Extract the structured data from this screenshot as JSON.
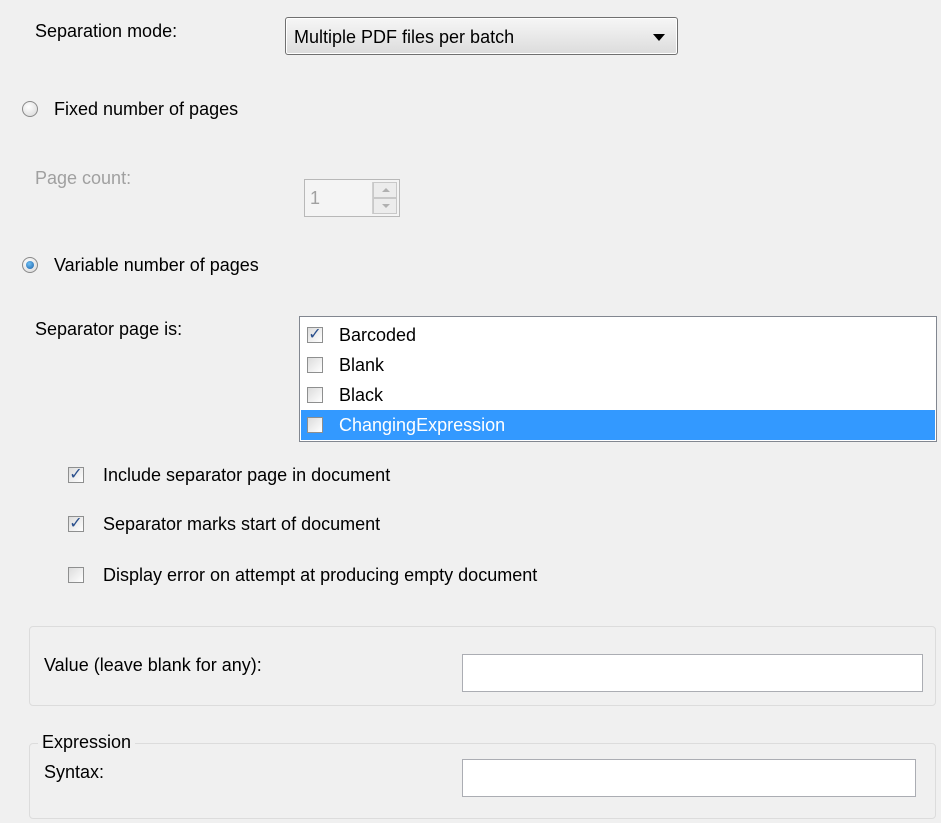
{
  "separation_mode": {
    "label": "Separation mode:",
    "selected": "Multiple PDF files per batch"
  },
  "fixed_pages": {
    "label": "Fixed number of pages",
    "selected": false
  },
  "page_count": {
    "label": "Page count:",
    "value": "1"
  },
  "variable_pages": {
    "label": "Variable number of pages",
    "selected": true
  },
  "separator_page": {
    "label": "Separator page is:",
    "items": [
      {
        "label": "Barcoded",
        "checked": true,
        "selected": false
      },
      {
        "label": "Blank",
        "checked": false,
        "selected": false
      },
      {
        "label": "Black",
        "checked": false,
        "selected": false
      },
      {
        "label": "ChangingExpression",
        "checked": false,
        "selected": true
      }
    ]
  },
  "options": {
    "include_separator": {
      "label": "Include separator page in document",
      "checked": true
    },
    "marks_start": {
      "label": "Separator marks start of document",
      "checked": true
    },
    "display_error": {
      "label": "Display error on attempt at producing empty document",
      "checked": false
    }
  },
  "value_field": {
    "label": "Value (leave blank for any):",
    "value": ""
  },
  "expression": {
    "group_label": "Expression",
    "syntax_label": "Syntax:",
    "value": ""
  },
  "colors": {
    "background": "#f0f0f0",
    "selection": "#3399ff",
    "disabled_text": "#a0a0a0"
  }
}
